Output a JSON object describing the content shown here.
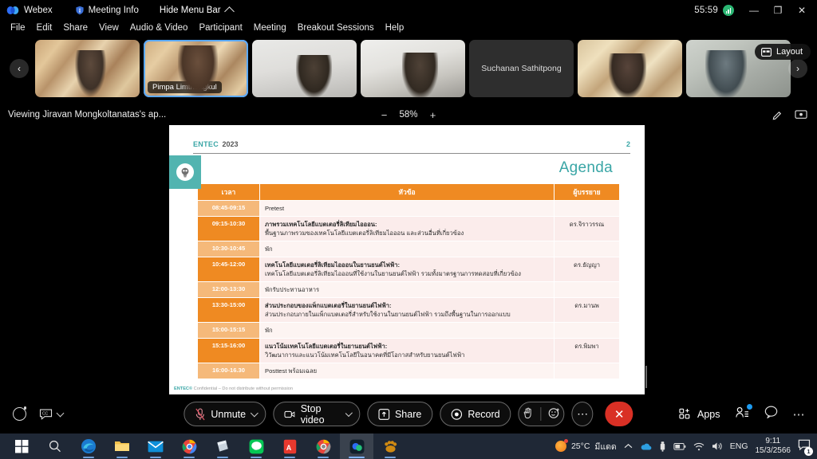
{
  "titlebar": {
    "app_name": "Webex",
    "meeting_info": "Meeting Info",
    "hide_menu_bar": "Hide Menu Bar",
    "timer": "55:59",
    "minimize": "—",
    "restore": "❐",
    "close": "✕"
  },
  "menubar": {
    "items": [
      {
        "label": "File"
      },
      {
        "label": "Edit"
      },
      {
        "label": "Share"
      },
      {
        "label": "View"
      },
      {
        "label": "Audio & Video"
      },
      {
        "label": "Participant"
      },
      {
        "label": "Meeting"
      },
      {
        "label": "Breakout Sessions"
      },
      {
        "label": "Help"
      }
    ]
  },
  "filmstrip": {
    "prev_label": "‹",
    "next_label": "›",
    "layout_label": "Layout",
    "tiles": [
      {
        "name": "",
        "badge": ""
      },
      {
        "name": "Pimpa Limthongkul",
        "badge": "Pimpa Limthongkul"
      },
      {
        "name": "",
        "badge": ""
      },
      {
        "name": "",
        "badge": ""
      },
      {
        "name": "Suchanan Sathitpong",
        "badge": ""
      },
      {
        "name": "",
        "badge": ""
      },
      {
        "name": "",
        "badge": ""
      }
    ]
  },
  "viewbar": {
    "viewing_label": "Viewing Jiravan Mongkoltanatas's ap...",
    "zoom_out": "−",
    "zoom_level": "58%",
    "zoom_in": "+"
  },
  "slide": {
    "brand": "ENTEC",
    "year": "2023",
    "page_number": "2",
    "title": "Agenda",
    "footer_brand": "ENTEC©",
    "footer_text": "Confidential – Do not distribute without permission",
    "table": {
      "headers": [
        "เวลา",
        "หัวข้อ",
        "ผู้บรรยาย"
      ],
      "rows": [
        {
          "time": "08:45-09:15",
          "topic_head": "Pretest",
          "topic_sub": "",
          "speaker": "",
          "shade": true
        },
        {
          "time": "09:15-10:30",
          "topic_head": "ภาพรวมเทคโนโลยีแบตเตอรี่ลิเทียมไอออน:",
          "topic_sub": "พื้นฐานภาพรวมของเทคโนโลยีแบตเตอรี่ลิเทียมไอออน และส่วนอื่นที่เกี่ยวข้อง",
          "speaker": "ดร.จิราวรรณ",
          "shade": false
        },
        {
          "time": "10:30-10:45",
          "topic_head": "พัก",
          "topic_sub": "",
          "speaker": "",
          "shade": true
        },
        {
          "time": "10:45-12:00",
          "topic_head": "เทคโนโลยีแบตเตอรี่ลิเทียมไอออนในยานยนต์ไฟฟ้า:",
          "topic_sub": "เทคโนโลยีแบตเตอรี่ลิเทียมไอออนที่ใช้งานในยานยนต์ไฟฟ้า รวมทั้งมาตรฐานการทดสอบที่เกี่ยวข้อง",
          "speaker": "ดร.ธัญญา",
          "shade": false
        },
        {
          "time": "12:00-13:30",
          "topic_head": "พักรับประทานอาหาร",
          "topic_sub": "",
          "speaker": "",
          "shade": true
        },
        {
          "time": "13:30-15:00",
          "topic_head": "ส่วนประกอบของแพ็กแบตเตอรี่ในยานยนต์ไฟฟ้า:",
          "topic_sub": "ส่วนประกอบภายในแพ็กแบตเตอรี่สำหรับใช้งานในยานยนต์ไฟฟ้า รวมถึงพื้นฐานในการออกแบบ",
          "speaker": "ดร.มานพ",
          "shade": false
        },
        {
          "time": "15:00-15:15",
          "topic_head": "พัก",
          "topic_sub": "",
          "speaker": "",
          "shade": true
        },
        {
          "time": "15:15-16:00",
          "topic_head": "แนวโน้มเทคโนโลยีแบตเตอรี่ในยานยนต์ไฟฟ้า:",
          "topic_sub": "วิวัฒนาการและแนวโน้มเทคโนโลยีในอนาคตที่มีโอกาสสำหรับยานยนต์ไฟฟ้า",
          "speaker": "ดร.พิมพา",
          "shade": false
        },
        {
          "time": "16:00-16.30",
          "topic_head": "Posttest พร้อมเฉลย",
          "topic_sub": "",
          "speaker": "",
          "shade": true
        }
      ]
    }
  },
  "controlbar": {
    "unmute_label": "Unmute",
    "stop_video_label": "Stop video",
    "share_label": "Share",
    "record_label": "Record",
    "more_label": "⋯",
    "end_label": "✕",
    "apps_label": "Apps",
    "right_more_label": "⋯"
  },
  "taskbar": {
    "temperature": "25°C",
    "weather_text": "มีแดด",
    "language": "ENG",
    "time": "9:11",
    "date": "15/3/2566",
    "notification_count": "1"
  }
}
